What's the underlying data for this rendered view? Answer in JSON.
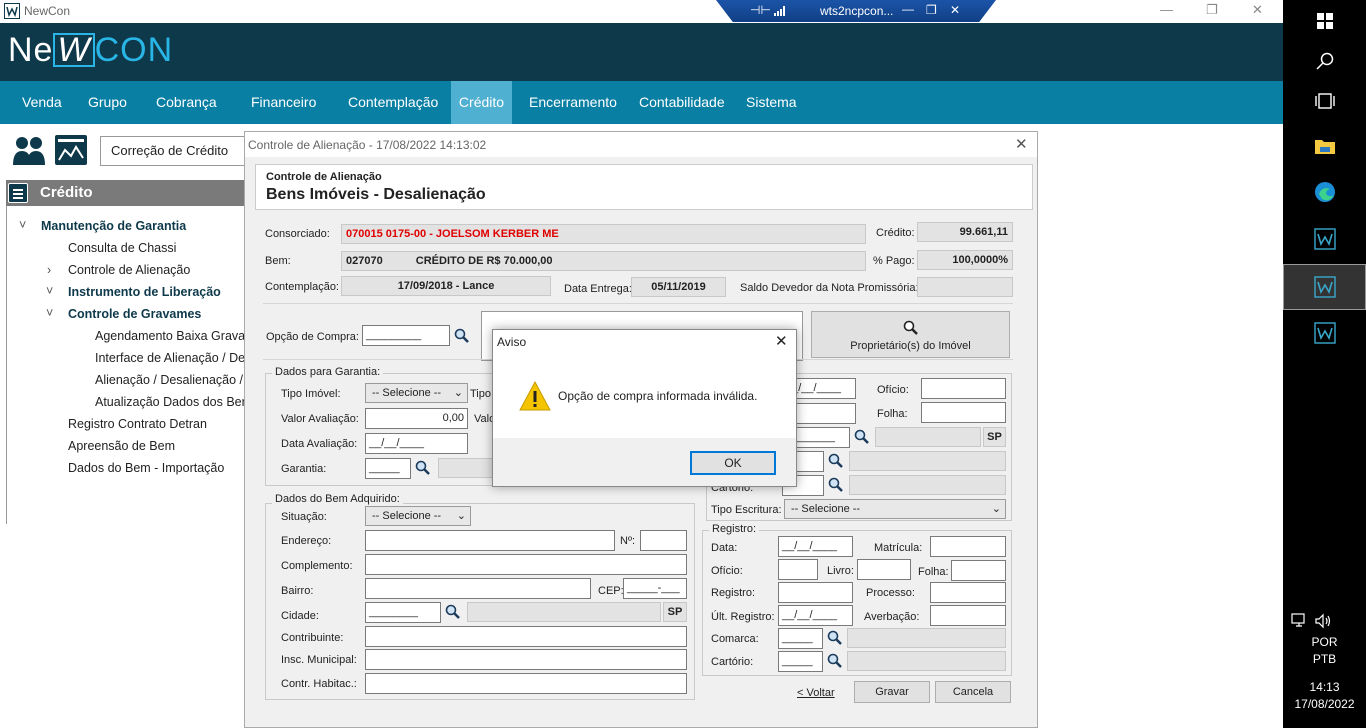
{
  "window": {
    "app_name": "NewCon"
  },
  "remote_desktop": {
    "host": "wts2ncpcon..."
  },
  "brand": {
    "logo_left": "Ne",
    "logo_mid": "W",
    "logo_right": "CON",
    "accent": "#29b6e6"
  },
  "menu": [
    "Venda",
    "Grupo",
    "Cobrança",
    "Financeiro",
    "Contemplação",
    "Crédito",
    "Encerramento",
    "Contabilidade",
    "Sistema"
  ],
  "menu_active": "Crédito",
  "toolbar": {
    "search_value": "Correção de Crédito"
  },
  "sidebar": {
    "title": "Crédito",
    "items": [
      {
        "label": "Manutenção de Garantia",
        "level": 0,
        "bold": true,
        "expander": "˅"
      },
      {
        "label": "Consulta de Chassi",
        "level": 1
      },
      {
        "label": "Controle de Alienação",
        "level": 1,
        "expander": "›"
      },
      {
        "label": "Instrumento de Liberação",
        "level": 1,
        "bold": true,
        "expander": "˅"
      },
      {
        "label": "Controle de Gravames",
        "level": 1,
        "bold": true,
        "expander": "˅"
      },
      {
        "label": "Agendamento Baixa Gravam",
        "level": 2
      },
      {
        "label": "Interface de Alienação / Des",
        "level": 2
      },
      {
        "label": "Alienação / Desalienação /",
        "level": 2
      },
      {
        "label": "Atualização Dados dos Ben",
        "level": 2
      },
      {
        "label": "Registro Contrato Detran",
        "level": 1
      },
      {
        "label": "Apreensão de Bem",
        "level": 1
      },
      {
        "label": "Dados do Bem - Importação",
        "level": 1
      }
    ]
  },
  "dialog": {
    "title": "Controle de Alienação - 17/08/2022  14:13:02",
    "subtitle": "Controle de Alienação",
    "heading": "Bens Imóveis - Desalienação",
    "consorciado_label": "Consorciado:",
    "consorciado_value": "070015 0175-00 - JOELSOM KERBER ME",
    "credito_label": "Crédito:",
    "credito_value": "99.661,11",
    "bem_label": "Bem:",
    "bem_code": "027070",
    "bem_desc": "CRÉDITO DE R$ 70.000,00",
    "pago_label": "% Pago:",
    "pago_value": "100,0000%",
    "contemplacao_label": "Contemplação:",
    "contemplacao_value": "17/09/2018 - Lance",
    "entrega_label": "Data Entrega:",
    "entrega_value": "05/11/2019",
    "saldo_label": "Saldo Devedor da Nota Promissória:",
    "opcao_label": "Opção de Compra:",
    "opcao_value": "_________",
    "proprietario_button": "Proprietário(s) do Imóvel",
    "garantia": {
      "title": "Dados para Garantia:",
      "tipo_imovel_label": "Tipo Imóvel:",
      "tipo_imovel_value": "-- Selecione --",
      "tipo_label": "Tipo",
      "valor_label": "Valor Avaliação:",
      "valor_value": "0,00",
      "valor2_label": "Valo",
      "data_label": "Data Avaliação:",
      "data_value": "__/__/____",
      "garantia_label": "Garantia:",
      "garantia_value": "_____"
    },
    "bem_adquirido": {
      "title": "Dados do Bem Adquirido:",
      "situacao_label": "Situação:",
      "situacao_value": "-- Selecione --",
      "endereco_label": "Endereço:",
      "numero_label": "Nº:",
      "complemento_label": "Complemento:",
      "bairro_label": "Bairro:",
      "cep_label": "CEP:",
      "cep_value": "_____-___",
      "cidade_label": "Cidade:",
      "cidade_value": "________",
      "uf_value": "SP",
      "contribuinte_label": "Contribuinte:",
      "insc_label": "Insc. Municipal:",
      "habitac_label": "Contr. Habitac.:"
    },
    "right_top": {
      "date_value": "__/__/____",
      "oficio_label": "Ofício:",
      "folha_label": "Folha:",
      "cidade_value": "________",
      "uf_value": "SP",
      "cartorio_label": "Cartório:",
      "tipo_escritura_label": "Tipo Escritura:",
      "tipo_escritura_value": "-- Selecione --"
    },
    "registro": {
      "title": "Registro:",
      "data_label": "Data:",
      "data_value": "__/__/____",
      "matricula_label": "Matrícula:",
      "oficio_label": "Ofício:",
      "livro_label": "Livro:",
      "folha_label": "Folha:",
      "registro_label": "Registro:",
      "processo_label": "Processo:",
      "ult_label": "Últ. Registro:",
      "ult_value": "__/__/____",
      "averbacao_label": "Averbação:",
      "comarca_label": "Comarca:",
      "comarca_value": "_____",
      "cartorio_label": "Cartório:",
      "cartorio_value": "_____"
    },
    "buttons": {
      "voltar": "< Voltar",
      "gravar": "Gravar",
      "cancela": "Cancela"
    }
  },
  "alert": {
    "title": "Aviso",
    "message": "Opção de compra informada inválida.",
    "ok": "OK"
  },
  "tray": {
    "lang1": "POR",
    "lang2": "PTB",
    "time": "14:13",
    "date": "17/08/2022"
  }
}
